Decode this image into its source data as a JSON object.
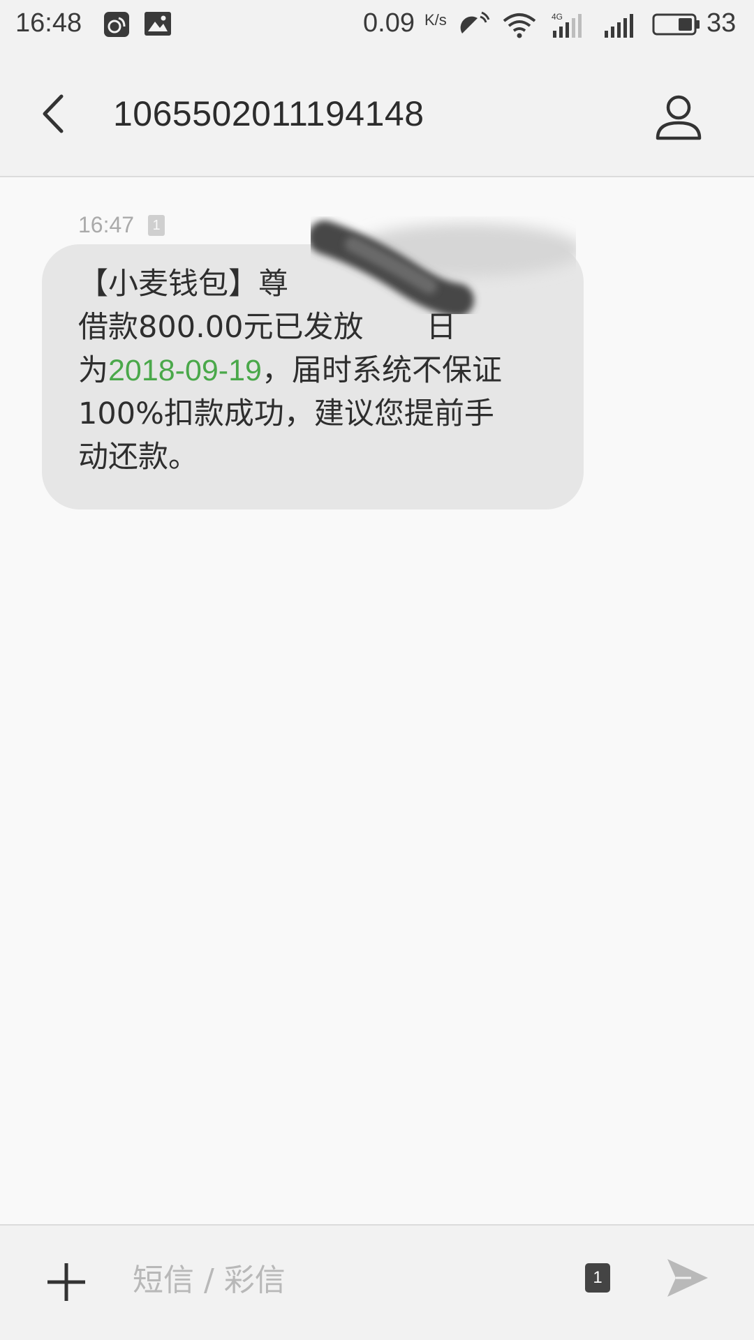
{
  "status_bar": {
    "time": "16:48",
    "net_speed": "0.09",
    "net_speed_unit": "K/s",
    "battery_level": "33",
    "icons": [
      "uc-browser-icon",
      "gallery-icon",
      "signal-strength-icon",
      "wifi-icon",
      "4g-signal-icon",
      "cell-signal-icon",
      "battery-icon"
    ]
  },
  "header": {
    "title": "1065502011194148",
    "back_icon": "chevron-left-icon",
    "contact_icon": "person-icon"
  },
  "messages": [
    {
      "time": "16:47",
      "sim": "1",
      "text_before": "【小麦钱包】尊",
      "text_line2": "借款800.00元已发放",
      "text_line2_tail": "日",
      "text_line3_prefix": "为",
      "date_link": "2018-09-19",
      "text_line3_suffix": "，届时系统不保证",
      "text_line4": "100%扣款成功，建议您提前手",
      "text_line5": "动还款。"
    }
  ],
  "compose": {
    "placeholder": "短信 / 彩信",
    "value": "",
    "sim": "1",
    "add_icon": "plus-icon",
    "send_icon": "send-icon"
  },
  "colors": {
    "accent_link": "#4aa84a",
    "bubble_bg": "#e6e6e6",
    "bar_bg": "#f2f2f2"
  }
}
